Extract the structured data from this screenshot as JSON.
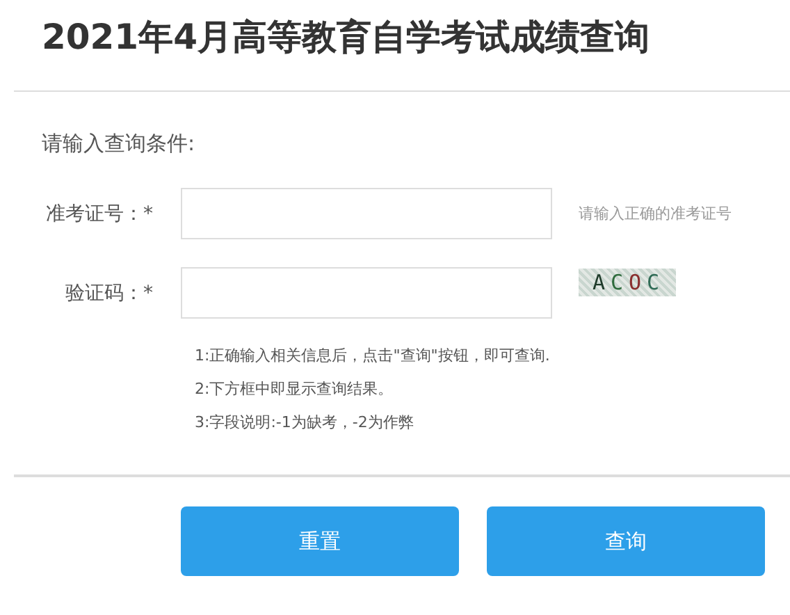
{
  "title": "2021年4月高等教育自学考试成绩查询",
  "prompt": "请输入查询条件:",
  "fields": [
    {
      "label": "准考证号：*",
      "hint": "请输入正确的准考证号",
      "kind": "text"
    },
    {
      "label": "验证码：*",
      "captcha": "ACOC",
      "kind": "captcha"
    }
  ],
  "notes": [
    "1:正确输入相关信息后，点击\"查询\"按钮，即可查询.",
    "2:下方框中即显示查询结果。",
    "3:字段说明:-1为缺考，-2为作弊"
  ],
  "buttons": [
    "重置",
    "查询"
  ]
}
